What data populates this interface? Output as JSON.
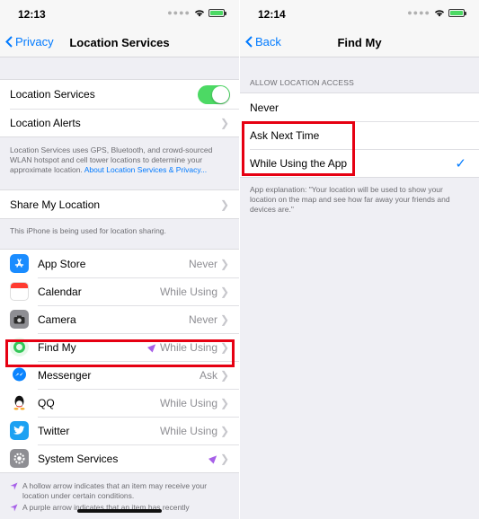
{
  "left": {
    "status_time": "12:13",
    "nav": {
      "back_label": "Privacy",
      "title": "Location Services"
    },
    "location_services": {
      "label": "Location Services",
      "enabled": true
    },
    "location_alerts": {
      "label": "Location Alerts"
    },
    "description": "Location Services uses GPS, Bluetooth, and crowd-sourced WLAN hotspot and cell tower locations to determine your approximate location.",
    "description_link": "About Location Services & Privacy...",
    "share": {
      "label": "Share My Location",
      "note": "This iPhone is being used for location sharing."
    },
    "apps": [
      {
        "name": "App Store",
        "value": "Never",
        "icon": "app-store-icon",
        "arrow": false
      },
      {
        "name": "Calendar",
        "value": "While Using",
        "icon": "calendar-icon",
        "arrow": false
      },
      {
        "name": "Camera",
        "value": "Never",
        "icon": "camera-icon",
        "arrow": false
      },
      {
        "name": "Find My",
        "value": "While Using",
        "icon": "find-my-icon",
        "arrow": true
      },
      {
        "name": "Messenger",
        "value": "Ask",
        "icon": "messenger-icon",
        "arrow": false
      },
      {
        "name": "QQ",
        "value": "While Using",
        "icon": "qq-icon",
        "arrow": false
      },
      {
        "name": "Twitter",
        "value": "While Using",
        "icon": "twitter-icon",
        "arrow": false
      },
      {
        "name": "System Services",
        "value": "",
        "icon": "gear-icon",
        "arrow": true
      }
    ],
    "footer_note_1": "A hollow arrow indicates that an item may receive your location under certain conditions.",
    "footer_note_2": "A purple arrow indicates that an item has recently"
  },
  "right": {
    "status_time": "12:14",
    "nav": {
      "back_label": "Back",
      "title": "Find My"
    },
    "section_header": "ALLOW LOCATION ACCESS",
    "options": [
      {
        "label": "Never",
        "selected": false
      },
      {
        "label": "Ask Next Time",
        "selected": false
      },
      {
        "label": "While Using the App",
        "selected": true
      }
    ],
    "explanation": "App explanation: \"Your location will be used to show your location on the map and see how far away your friends and devices are.\""
  },
  "colors": {
    "accent": "#007aff",
    "toggle_on": "#4cd964",
    "highlight": "#e60012",
    "location_arrow": "#a760e8"
  }
}
